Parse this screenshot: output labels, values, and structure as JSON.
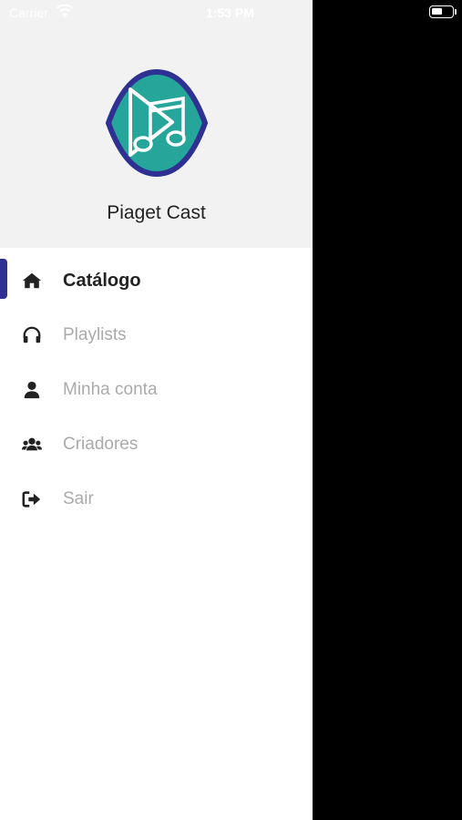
{
  "status_bar": {
    "carrier": "Carrier",
    "time": "1:53 PM"
  },
  "drawer": {
    "app_name": "Piaget Cast",
    "logo_colors": {
      "border": "#2e3192",
      "fill": "#26a69a"
    },
    "menu": [
      {
        "label": "Catálogo",
        "icon": "home-icon",
        "active": true
      },
      {
        "label": "Playlists",
        "icon": "headphones-icon",
        "active": false
      },
      {
        "label": "Minha conta",
        "icon": "user-icon",
        "active": false
      },
      {
        "label": "Criadores",
        "icon": "users-icon",
        "active": false
      },
      {
        "label": "Sair",
        "icon": "sign-out-icon",
        "active": false
      }
    ],
    "accent_color": "#2e3192"
  }
}
